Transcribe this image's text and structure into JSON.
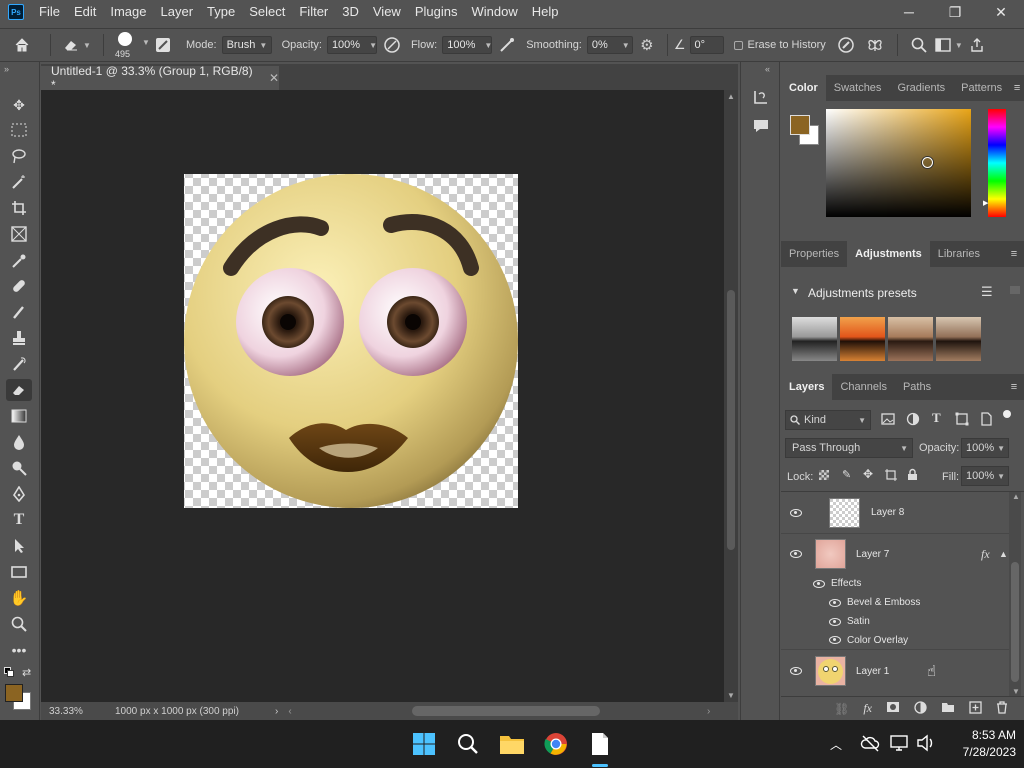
{
  "menubar": {
    "items": [
      "File",
      "Edit",
      "Image",
      "Layer",
      "Type",
      "Select",
      "Filter",
      "3D",
      "View",
      "Plugins",
      "Window",
      "Help"
    ],
    "logo": "Ps"
  },
  "window_controls": {
    "minimize": "─",
    "restore": "❐",
    "close": "✕"
  },
  "options": {
    "brush_size": "495",
    "mode_label": "Mode:",
    "mode_value": "Brush",
    "opacity_label": "Opacity:",
    "opacity_value": "100%",
    "flow_label": "Flow:",
    "flow_value": "100%",
    "smoothing_label": "Smoothing:",
    "smoothing_value": "0%",
    "angle_value": "0°",
    "erase_history_label": "Erase to History"
  },
  "document": {
    "tab_title": "Untitled-1 @ 33.3% (Group 1, RGB/8) *",
    "zoom": "33.33%",
    "doc_info": "1000 px x 1000 px (300 ppi)"
  },
  "color_panel": {
    "tabs": [
      "Color",
      "Swatches",
      "Gradients",
      "Patterns"
    ],
    "foreground": "#8b6422",
    "background": "#ffffff",
    "hue": "#e8a417"
  },
  "adjustments_panel": {
    "tabs": [
      "Properties",
      "Adjustments",
      "Libraries"
    ],
    "presets_title": "Adjustments presets"
  },
  "layers_panel": {
    "tabs": [
      "Layers",
      "Channels",
      "Paths"
    ],
    "filter_kind": "Kind",
    "blend_mode": "Pass Through",
    "opacity_label": "Opacity:",
    "opacity_value": "100%",
    "lock_label": "Lock:",
    "fill_label": "Fill:",
    "fill_value": "100%",
    "layers": [
      {
        "name": "Layer 8"
      },
      {
        "name": "Layer 7",
        "fx": "fx"
      },
      {
        "name": "Layer 1"
      }
    ],
    "effects_label": "Effects",
    "effects": [
      "Bevel & Emboss",
      "Satin",
      "Color Overlay"
    ]
  },
  "taskbar": {
    "time": "8:53 AM",
    "date": "7/28/2023"
  }
}
